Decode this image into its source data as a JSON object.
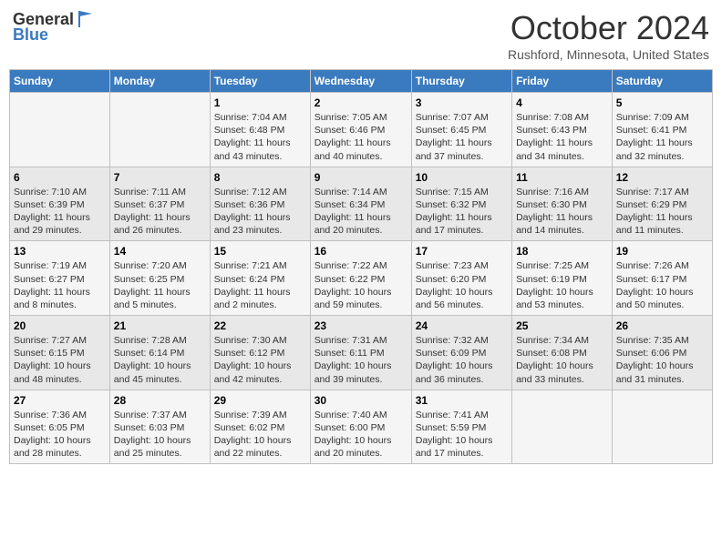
{
  "header": {
    "logo_general": "General",
    "logo_blue": "Blue",
    "title": "October 2024",
    "location": "Rushford, Minnesota, United States"
  },
  "days_of_week": [
    "Sunday",
    "Monday",
    "Tuesday",
    "Wednesday",
    "Thursday",
    "Friday",
    "Saturday"
  ],
  "weeks": [
    [
      {
        "day": "",
        "sunrise": "",
        "sunset": "",
        "daylight": ""
      },
      {
        "day": "",
        "sunrise": "",
        "sunset": "",
        "daylight": ""
      },
      {
        "day": "1",
        "sunrise": "Sunrise: 7:04 AM",
        "sunset": "Sunset: 6:48 PM",
        "daylight": "Daylight: 11 hours and 43 minutes."
      },
      {
        "day": "2",
        "sunrise": "Sunrise: 7:05 AM",
        "sunset": "Sunset: 6:46 PM",
        "daylight": "Daylight: 11 hours and 40 minutes."
      },
      {
        "day": "3",
        "sunrise": "Sunrise: 7:07 AM",
        "sunset": "Sunset: 6:45 PM",
        "daylight": "Daylight: 11 hours and 37 minutes."
      },
      {
        "day": "4",
        "sunrise": "Sunrise: 7:08 AM",
        "sunset": "Sunset: 6:43 PM",
        "daylight": "Daylight: 11 hours and 34 minutes."
      },
      {
        "day": "5",
        "sunrise": "Sunrise: 7:09 AM",
        "sunset": "Sunset: 6:41 PM",
        "daylight": "Daylight: 11 hours and 32 minutes."
      }
    ],
    [
      {
        "day": "6",
        "sunrise": "Sunrise: 7:10 AM",
        "sunset": "Sunset: 6:39 PM",
        "daylight": "Daylight: 11 hours and 29 minutes."
      },
      {
        "day": "7",
        "sunrise": "Sunrise: 7:11 AM",
        "sunset": "Sunset: 6:37 PM",
        "daylight": "Daylight: 11 hours and 26 minutes."
      },
      {
        "day": "8",
        "sunrise": "Sunrise: 7:12 AM",
        "sunset": "Sunset: 6:36 PM",
        "daylight": "Daylight: 11 hours and 23 minutes."
      },
      {
        "day": "9",
        "sunrise": "Sunrise: 7:14 AM",
        "sunset": "Sunset: 6:34 PM",
        "daylight": "Daylight: 11 hours and 20 minutes."
      },
      {
        "day": "10",
        "sunrise": "Sunrise: 7:15 AM",
        "sunset": "Sunset: 6:32 PM",
        "daylight": "Daylight: 11 hours and 17 minutes."
      },
      {
        "day": "11",
        "sunrise": "Sunrise: 7:16 AM",
        "sunset": "Sunset: 6:30 PM",
        "daylight": "Daylight: 11 hours and 14 minutes."
      },
      {
        "day": "12",
        "sunrise": "Sunrise: 7:17 AM",
        "sunset": "Sunset: 6:29 PM",
        "daylight": "Daylight: 11 hours and 11 minutes."
      }
    ],
    [
      {
        "day": "13",
        "sunrise": "Sunrise: 7:19 AM",
        "sunset": "Sunset: 6:27 PM",
        "daylight": "Daylight: 11 hours and 8 minutes."
      },
      {
        "day": "14",
        "sunrise": "Sunrise: 7:20 AM",
        "sunset": "Sunset: 6:25 PM",
        "daylight": "Daylight: 11 hours and 5 minutes."
      },
      {
        "day": "15",
        "sunrise": "Sunrise: 7:21 AM",
        "sunset": "Sunset: 6:24 PM",
        "daylight": "Daylight: 11 hours and 2 minutes."
      },
      {
        "day": "16",
        "sunrise": "Sunrise: 7:22 AM",
        "sunset": "Sunset: 6:22 PM",
        "daylight": "Daylight: 10 hours and 59 minutes."
      },
      {
        "day": "17",
        "sunrise": "Sunrise: 7:23 AM",
        "sunset": "Sunset: 6:20 PM",
        "daylight": "Daylight: 10 hours and 56 minutes."
      },
      {
        "day": "18",
        "sunrise": "Sunrise: 7:25 AM",
        "sunset": "Sunset: 6:19 PM",
        "daylight": "Daylight: 10 hours and 53 minutes."
      },
      {
        "day": "19",
        "sunrise": "Sunrise: 7:26 AM",
        "sunset": "Sunset: 6:17 PM",
        "daylight": "Daylight: 10 hours and 50 minutes."
      }
    ],
    [
      {
        "day": "20",
        "sunrise": "Sunrise: 7:27 AM",
        "sunset": "Sunset: 6:15 PM",
        "daylight": "Daylight: 10 hours and 48 minutes."
      },
      {
        "day": "21",
        "sunrise": "Sunrise: 7:28 AM",
        "sunset": "Sunset: 6:14 PM",
        "daylight": "Daylight: 10 hours and 45 minutes."
      },
      {
        "day": "22",
        "sunrise": "Sunrise: 7:30 AM",
        "sunset": "Sunset: 6:12 PM",
        "daylight": "Daylight: 10 hours and 42 minutes."
      },
      {
        "day": "23",
        "sunrise": "Sunrise: 7:31 AM",
        "sunset": "Sunset: 6:11 PM",
        "daylight": "Daylight: 10 hours and 39 minutes."
      },
      {
        "day": "24",
        "sunrise": "Sunrise: 7:32 AM",
        "sunset": "Sunset: 6:09 PM",
        "daylight": "Daylight: 10 hours and 36 minutes."
      },
      {
        "day": "25",
        "sunrise": "Sunrise: 7:34 AM",
        "sunset": "Sunset: 6:08 PM",
        "daylight": "Daylight: 10 hours and 33 minutes."
      },
      {
        "day": "26",
        "sunrise": "Sunrise: 7:35 AM",
        "sunset": "Sunset: 6:06 PM",
        "daylight": "Daylight: 10 hours and 31 minutes."
      }
    ],
    [
      {
        "day": "27",
        "sunrise": "Sunrise: 7:36 AM",
        "sunset": "Sunset: 6:05 PM",
        "daylight": "Daylight: 10 hours and 28 minutes."
      },
      {
        "day": "28",
        "sunrise": "Sunrise: 7:37 AM",
        "sunset": "Sunset: 6:03 PM",
        "daylight": "Daylight: 10 hours and 25 minutes."
      },
      {
        "day": "29",
        "sunrise": "Sunrise: 7:39 AM",
        "sunset": "Sunset: 6:02 PM",
        "daylight": "Daylight: 10 hours and 22 minutes."
      },
      {
        "day": "30",
        "sunrise": "Sunrise: 7:40 AM",
        "sunset": "Sunset: 6:00 PM",
        "daylight": "Daylight: 10 hours and 20 minutes."
      },
      {
        "day": "31",
        "sunrise": "Sunrise: 7:41 AM",
        "sunset": "Sunset: 5:59 PM",
        "daylight": "Daylight: 10 hours and 17 minutes."
      },
      {
        "day": "",
        "sunrise": "",
        "sunset": "",
        "daylight": ""
      },
      {
        "day": "",
        "sunrise": "",
        "sunset": "",
        "daylight": ""
      }
    ]
  ]
}
